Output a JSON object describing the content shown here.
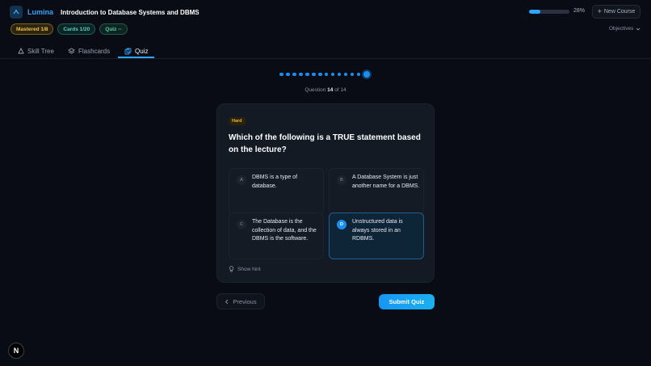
{
  "header": {
    "brand": "Lumina",
    "course_title": "Introduction to Database Systems and DBMS",
    "progress_percent": 28,
    "progress_text": "28%",
    "new_course_label": "New Course"
  },
  "badges": {
    "mastered": "Mastered 1/8",
    "cards": "Cards 1/20",
    "quiz": "Quiz --"
  },
  "objectives_label": "Objectives",
  "tabs": [
    {
      "label": "Skill Tree",
      "icon": "triangle-icon",
      "active": false
    },
    {
      "label": "Flashcards",
      "icon": "layers-icon",
      "active": false
    },
    {
      "label": "Quiz",
      "icon": "quiz-icon",
      "active": true
    }
  ],
  "quiz": {
    "total_questions": 14,
    "current_question": 14,
    "counter_prefix": "Question",
    "counter_current": "14",
    "counter_of": "of 14",
    "difficulty": "Hard",
    "question": "Which of the following is a TRUE statement based on the lecture?",
    "options": [
      {
        "letter": "A",
        "text": "DBMS is a type of database.",
        "selected": false
      },
      {
        "letter": "B",
        "text": "A Database System is just another name for a DBMS.",
        "selected": false
      },
      {
        "letter": "C",
        "text": "The Database is the collection of data, and the DBMS is the software.",
        "selected": false
      },
      {
        "letter": "D",
        "text": "Unstructured data is always stored in an RDBMS.",
        "selected": true
      }
    ],
    "hint_label": "Show hint",
    "previous_label": "Previous",
    "submit_label": "Submit Quiz"
  },
  "corner_badge": "N",
  "colors": {
    "background": "#090c14",
    "accent": "#1a8ff0",
    "brand": "#2ea6ff",
    "hard_badge": "#eab53a"
  }
}
